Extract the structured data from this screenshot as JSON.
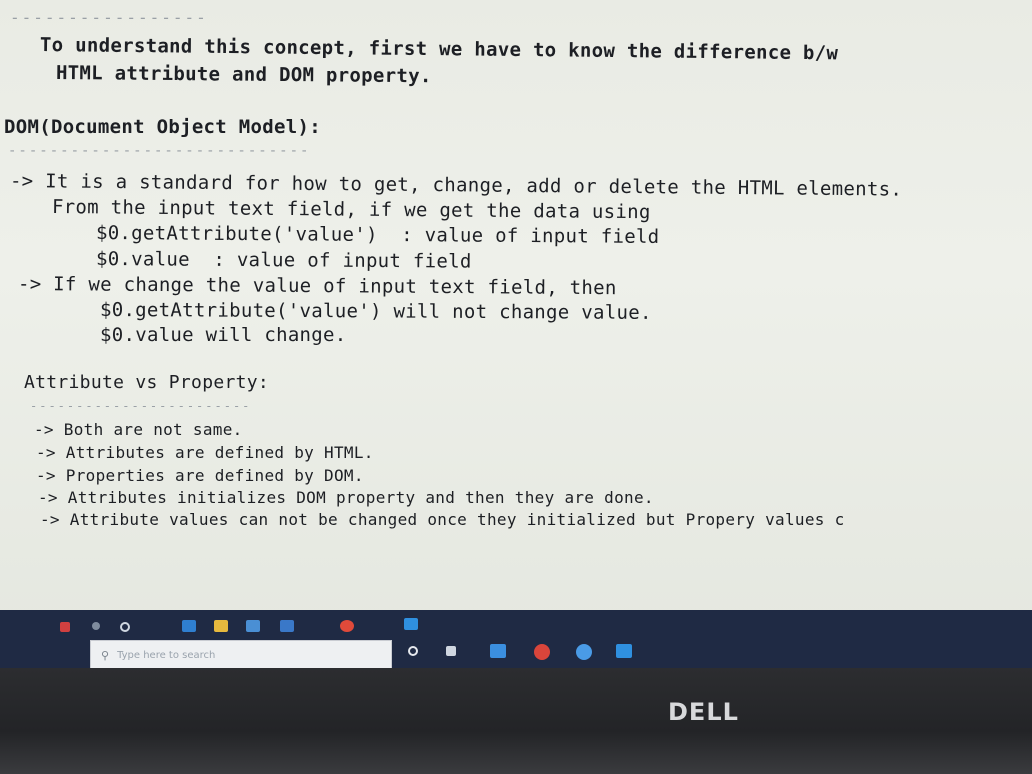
{
  "doc": {
    "dash_top": "-----------------",
    "intro_line1": "To understand this concept, first we have to know the difference b/w",
    "intro_line2": "HTML attribute and DOM property.",
    "dom_heading": "DOM(Document Object Model):",
    "dom_dashes": "-----------------------------",
    "dom_line1": "-> It is a standard for how to get, change, add or delete the HTML elements.",
    "dom_line2": "From the input text field, if we get the data using",
    "dom_line3": "$0.getAttribute('value')  : value of input field",
    "dom_line4": "$0.value  : value of input field",
    "dom_line5": "-> If we change the value of input text field, then",
    "dom_line6": "$0.getAttribute('value') will not change value.",
    "dom_line7": "$0.value will change.",
    "attr_heading": "Attribute vs Property:",
    "attr_dashes": "------------------------",
    "attr_items": [
      "-> Both are not same.",
      "-> Attributes are defined by HTML.",
      "-> Properties are defined by DOM.",
      "-> Attributes initializes DOM property and then they are done.",
      "-> Attribute values can not be changed once they initialized but Propery values c"
    ]
  },
  "taskbar": {
    "search_placeholder": "Type here to search",
    "icons": [
      "windows-icon",
      "search-icon",
      "task-view-icon",
      "edge-icon",
      "file-explorer-icon",
      "store-icon",
      "mail-icon",
      "chrome-icon",
      "vscode-icon"
    ]
  },
  "brand": "DELL"
}
